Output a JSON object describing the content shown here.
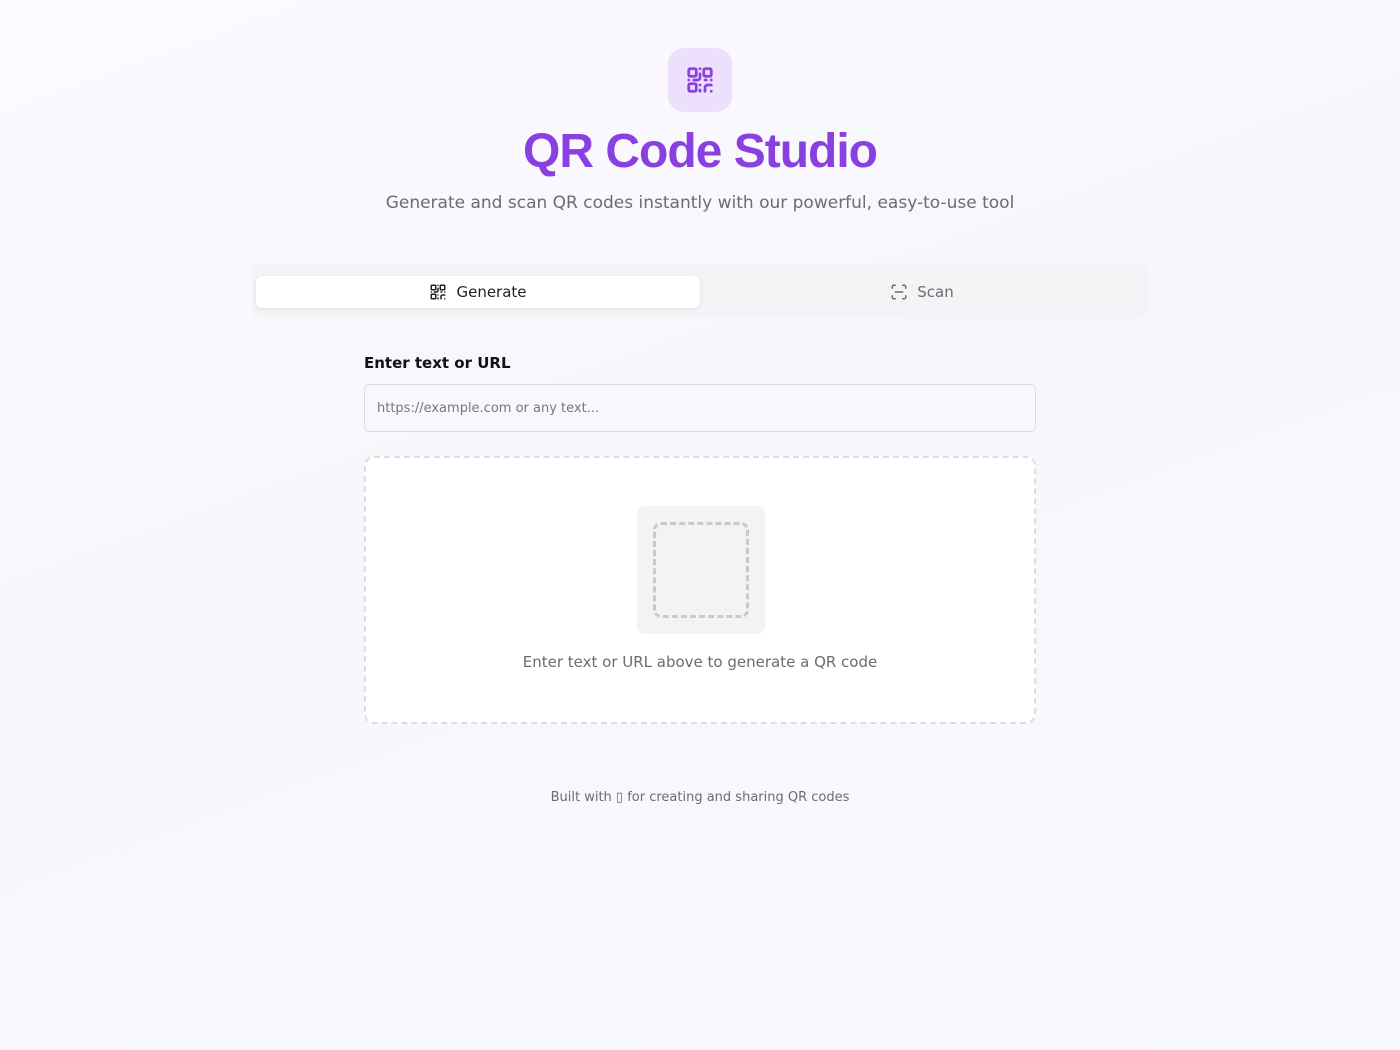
{
  "header": {
    "logo_icon": "qr-code-icon",
    "title": "QR Code Studio",
    "subtitle": "Generate and scan QR codes instantly with our powerful, easy-to-use tool"
  },
  "tabs": [
    {
      "label": "Generate",
      "icon": "qr-code-icon",
      "active": true
    },
    {
      "label": "Scan",
      "icon": "scan-icon",
      "active": false
    }
  ],
  "generate": {
    "input_label": "Enter text or URL",
    "input_value": "",
    "input_placeholder": "https://example.com or any text...",
    "empty_message": "Enter text or URL above to generate a QR code"
  },
  "footer": {
    "text": "Built with ▯ for creating and sharing QR codes"
  },
  "colors": {
    "accent": "#8a3fe0",
    "logo_bg": "#ece0fd"
  }
}
